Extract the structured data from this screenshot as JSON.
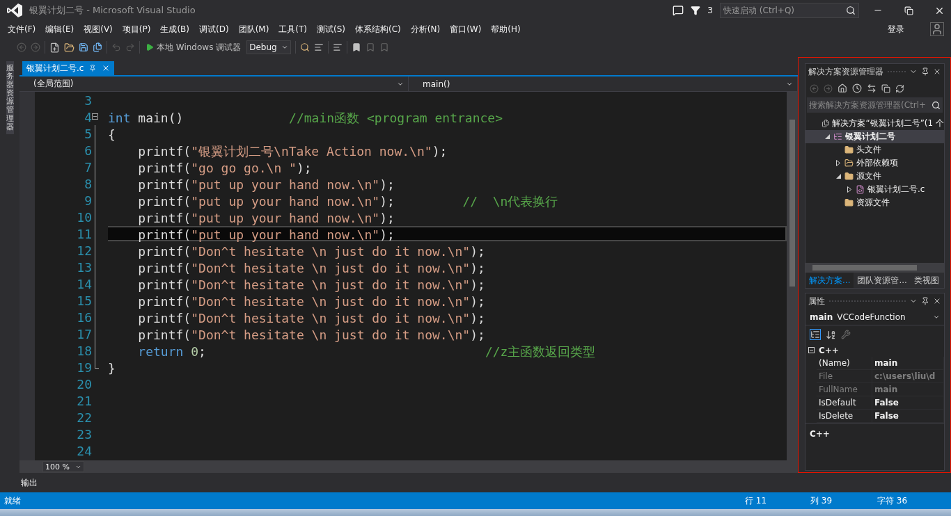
{
  "window": {
    "title": "银翼计划二号 - Microsoft Visual Studio",
    "notification_count": "3",
    "quick_launch": {
      "placeholder": "快速启动 (Ctrl+Q)"
    },
    "sign_in": "登录"
  },
  "menu": [
    "文件(F)",
    "编辑(E)",
    "视图(V)",
    "项目(P)",
    "生成(B)",
    "调试(D)",
    "团队(M)",
    "工具(T)",
    "测试(S)",
    "体系结构(C)",
    "分析(N)",
    "窗口(W)",
    "帮助(H)"
  ],
  "toolbar": {
    "debugger": "本地 Windows 调试器",
    "configuration": "Debug"
  },
  "side_tab": "服务器资源管理器",
  "editor": {
    "tabs": [
      {
        "label": "银翼计划二号.c",
        "selected": true
      }
    ],
    "scope": "(全局范围)",
    "member": "main()",
    "zoom": "100 %",
    "lines": [
      {
        "number": "3",
        "current": false
      },
      {
        "number": "4",
        "current": false,
        "fold_start": true,
        "tokens": [
          {
            "kind": "kw",
            "text": "int"
          },
          {
            "kind": "plain",
            "text": " main()              "
          },
          {
            "kind": "cmt",
            "text": "//main函数 <program entrance>"
          }
        ]
      },
      {
        "number": "5",
        "current": false,
        "in_fold": true,
        "tokens": [
          {
            "kind": "plain",
            "text": "{"
          }
        ]
      },
      {
        "number": "6",
        "current": false,
        "in_fold": true,
        "tokens": [
          {
            "kind": "plain",
            "text": "    printf("
          },
          {
            "kind": "str",
            "text": "\"银翼计划二号\\nTake Action now.\\n\""
          },
          {
            "kind": "plain",
            "text": ");"
          }
        ]
      },
      {
        "number": "7",
        "current": false,
        "in_fold": true,
        "tokens": [
          {
            "kind": "plain",
            "text": "    printf("
          },
          {
            "kind": "str",
            "text": "\"go go go.\\n \""
          },
          {
            "kind": "plain",
            "text": ");"
          }
        ]
      },
      {
        "number": "8",
        "current": false,
        "in_fold": true,
        "tokens": [
          {
            "kind": "plain",
            "text": "    printf("
          },
          {
            "kind": "str",
            "text": "\"put up your hand now.\\n\""
          },
          {
            "kind": "plain",
            "text": ");"
          }
        ]
      },
      {
        "number": "9",
        "current": false,
        "in_fold": true,
        "tokens": [
          {
            "kind": "plain",
            "text": "    printf("
          },
          {
            "kind": "str",
            "text": "\"put up your hand now.\\n\""
          },
          {
            "kind": "plain",
            "text": ");         "
          },
          {
            "kind": "cmt",
            "text": "//  \\n代表换行"
          }
        ]
      },
      {
        "number": "10",
        "current": false,
        "in_fold": true,
        "tokens": [
          {
            "kind": "plain",
            "text": "    printf("
          },
          {
            "kind": "str",
            "text": "\"put up your hand now.\\n\""
          },
          {
            "kind": "plain",
            "text": ");"
          }
        ]
      },
      {
        "number": "11",
        "current": true,
        "in_fold": true,
        "tokens": [
          {
            "kind": "plain",
            "text": "    printf("
          },
          {
            "kind": "str",
            "text": "\"put up your hand now.\\n\""
          },
          {
            "kind": "plain",
            "text": ");"
          }
        ]
      },
      {
        "number": "12",
        "current": false,
        "in_fold": true,
        "tokens": [
          {
            "kind": "plain",
            "text": "    printf("
          },
          {
            "kind": "str",
            "text": "\"Don^t hesitate \\n just do it now.\\n\""
          },
          {
            "kind": "plain",
            "text": ");"
          }
        ]
      },
      {
        "number": "13",
        "current": false,
        "in_fold": true,
        "tokens": [
          {
            "kind": "plain",
            "text": "    printf("
          },
          {
            "kind": "str",
            "text": "\"Don^t hesitate \\n just do it now.\\n\""
          },
          {
            "kind": "plain",
            "text": ");"
          }
        ]
      },
      {
        "number": "14",
        "current": false,
        "in_fold": true,
        "tokens": [
          {
            "kind": "plain",
            "text": "    printf("
          },
          {
            "kind": "str",
            "text": "\"Don^t hesitate \\n just do it now.\\n\""
          },
          {
            "kind": "plain",
            "text": ");"
          }
        ]
      },
      {
        "number": "15",
        "current": false,
        "in_fold": true,
        "tokens": [
          {
            "kind": "plain",
            "text": "    printf("
          },
          {
            "kind": "str",
            "text": "\"Don^t hesitate \\n just do it now.\\n\""
          },
          {
            "kind": "plain",
            "text": ");"
          }
        ]
      },
      {
        "number": "16",
        "current": false,
        "in_fold": true,
        "tokens": [
          {
            "kind": "plain",
            "text": "    printf("
          },
          {
            "kind": "str",
            "text": "\"Don^t hesitate \\n just do it now.\\n\""
          },
          {
            "kind": "plain",
            "text": ");"
          }
        ]
      },
      {
        "number": "17",
        "current": false,
        "in_fold": true,
        "tokens": [
          {
            "kind": "plain",
            "text": "    printf("
          },
          {
            "kind": "str",
            "text": "\"Don^t hesitate \\n just do it now.\\n\""
          },
          {
            "kind": "plain",
            "text": ");"
          }
        ]
      },
      {
        "number": "18",
        "current": false,
        "in_fold": true,
        "tokens": [
          {
            "kind": "kw",
            "text": "    return"
          },
          {
            "kind": "num",
            "text": " 0"
          },
          {
            "kind": "plain",
            "text": ";                                     "
          },
          {
            "kind": "cmt",
            "text": "//z主函数返回类型"
          }
        ]
      },
      {
        "number": "19",
        "current": false,
        "in_fold": true,
        "fold_end": true,
        "tokens": [
          {
            "kind": "plain",
            "text": "}"
          }
        ]
      },
      {
        "number": "20",
        "current": false
      },
      {
        "number": "21",
        "current": false
      },
      {
        "number": "22",
        "current": false
      },
      {
        "number": "23",
        "current": false
      },
      {
        "number": "24",
        "current": false
      }
    ]
  },
  "solution_explorer": {
    "title": "解决方案资源管理器",
    "search": {
      "placeholder": "搜索解决方案资源管理器(Ctrl+"
    },
    "tree": [
      {
        "label": "解决方案“银翼计划二号”(1 个",
        "kind": "solution",
        "selected": false,
        "children": [
          {
            "label": "银翼计划二号",
            "kind": "project",
            "selected": true,
            "expanded": true,
            "children": [
              {
                "label": "头文件",
                "kind": "folder",
                "selected": false
              },
              {
                "label": "外部依赖项",
                "kind": "deps",
                "selected": false,
                "expanded": false
              },
              {
                "label": "源文件",
                "kind": "folder",
                "selected": false,
                "expanded": true,
                "children": [
                  {
                    "label": "银翼计划二号.c",
                    "kind": "file",
                    "selected": false,
                    "expanded": false
                  }
                ]
              },
              {
                "label": "资源文件",
                "kind": "folder",
                "selected": false
              }
            ]
          }
        ]
      }
    ],
    "tabs": [
      {
        "label": "解决方案...",
        "selected": true
      },
      {
        "label": "团队资源管...",
        "selected": false
      },
      {
        "label": "类视图",
        "selected": false
      }
    ]
  },
  "properties": {
    "title": "属性",
    "object_name": "main",
    "object_type": "VCCodeFunction",
    "category": "C++",
    "rows": [
      {
        "name": "(Name)",
        "value": "main",
        "disabled": false
      },
      {
        "name": "File",
        "value": "c:\\users\\liu\\d",
        "disabled": true
      },
      {
        "name": "FullName",
        "value": "main",
        "disabled": true
      },
      {
        "name": "IsDefault",
        "value": "False",
        "disabled": false
      },
      {
        "name": "IsDelete",
        "value": "False",
        "disabled": false
      }
    ],
    "description": "C++"
  },
  "output_tab": "输出",
  "status_bar": {
    "state": "就绪",
    "line": "行 11",
    "column": "列 39",
    "char": "字符 36"
  }
}
